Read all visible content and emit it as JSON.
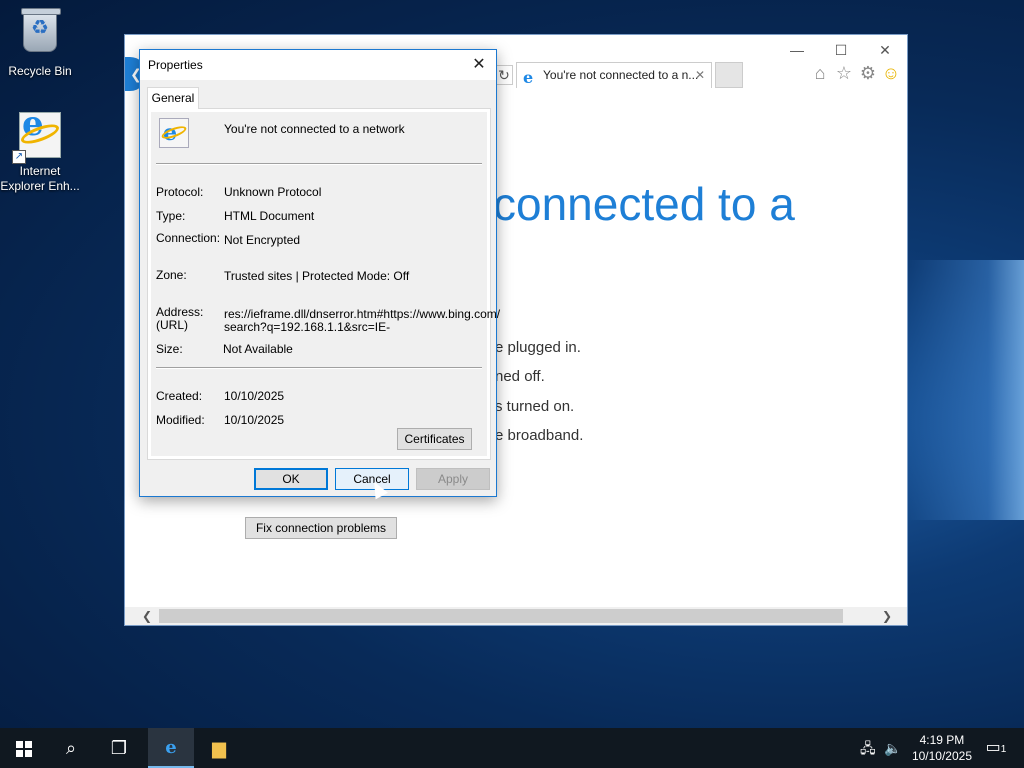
{
  "desktop": {
    "icons": [
      {
        "label": "Recycle Bin",
        "icon": "recycle-bin-icon"
      },
      {
        "label": "Internet Explorer Enh...",
        "icon": "internet-explorer-icon"
      }
    ]
  },
  "browser": {
    "tab_title": "You're not connected to a n...",
    "tab_close": "✕",
    "heading_visible": "connected to a",
    "suggestions": [
      "e plugged in.",
      "ned off.",
      "s turned on.",
      "e broadband."
    ],
    "fix_button": "Fix connection problems",
    "back_glyph": "❮",
    "refresh_glyph": "↻",
    "scroll_left": "❮",
    "scroll_right": "❯",
    "window_controls": {
      "minimize": "—",
      "maximize": "☐",
      "close": "✕"
    },
    "toolbar": {
      "home": "⌂",
      "favorites": "☆",
      "settings": "⚙",
      "feedback": "☺"
    }
  },
  "dialog": {
    "title": "Properties",
    "close_glyph": "✕",
    "tab": "General",
    "page_title": "You're not connected to a network",
    "fields": {
      "protocol_label": "Protocol:",
      "protocol_value": "Unknown Protocol",
      "type_label": "Type:",
      "type_value": "HTML Document",
      "connection_label": "Connection:",
      "connection_value": "Not Encrypted",
      "zone_label": "Zone:",
      "zone_value": "Trusted sites | Protected Mode: Off",
      "address_label": "Address:",
      "address_label2": "(URL)",
      "address_value1": "res://ieframe.dll/dnserror.htm#https://www.bing.com/",
      "address_value2": "search?q=192.168.1.1&src=IE-",
      "size_label": "Size:",
      "size_value": "Not Available",
      "created_label": "Created:",
      "created_value": "10/10/2025",
      "modified_label": "Modified:",
      "modified_value": "10/10/2025"
    },
    "certificates_button": "Certificates",
    "ok_button": "OK",
    "cancel_button": "Cancel",
    "apply_button": "Apply"
  },
  "taskbar": {
    "search_glyph": "⌕",
    "task_view_glyph": "❐",
    "ie_glyph": "e",
    "explorer_glyph": "▆",
    "network_glyph": "🖧",
    "volume_glyph": "🔈",
    "time": "4:19 PM",
    "date": "10/10/2025",
    "notification_glyph": "▭",
    "notification_count": "1"
  }
}
